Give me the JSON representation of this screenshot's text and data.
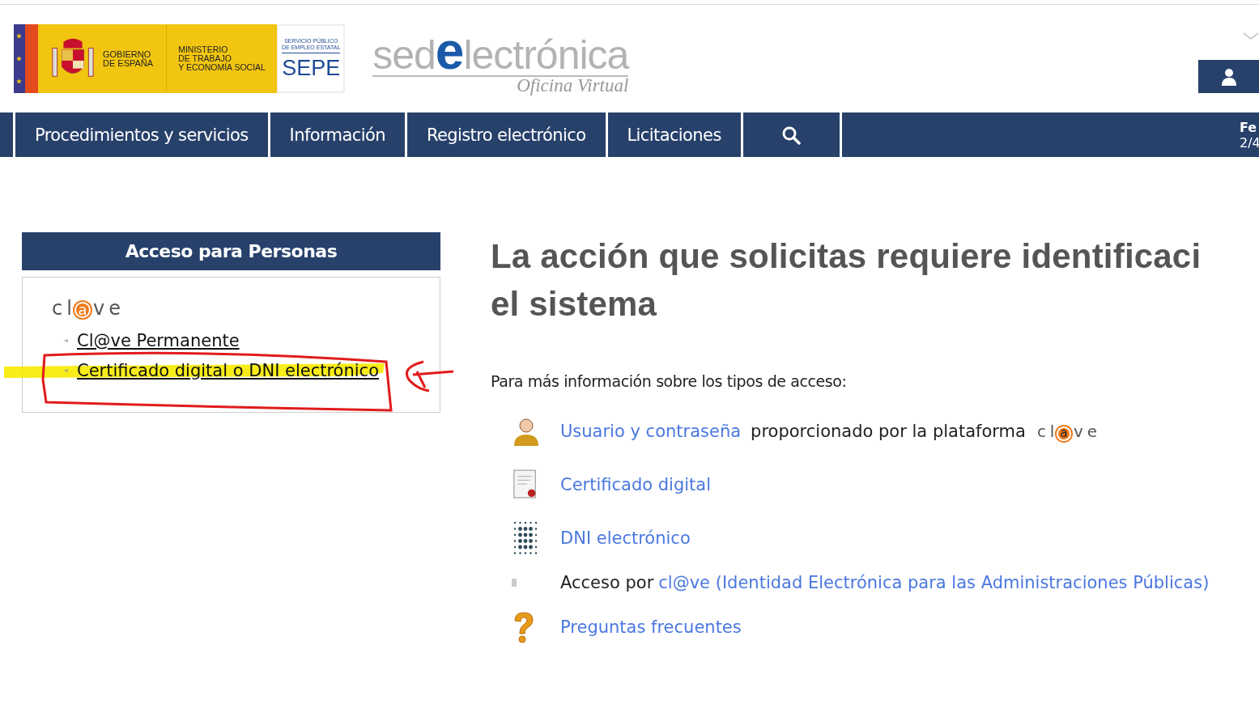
{
  "header": {
    "government": [
      "GOBIERNO",
      "DE ESPAÑA"
    ],
    "ministry": [
      "MINISTERIO",
      "DE TRABAJO",
      "Y ECONOMÍA SOCIAL"
    ],
    "agency": [
      "SERVICIO PÚBLICO",
      "DE EMPLEO ESTATAL"
    ],
    "agency_short": "SEPE",
    "site_title": [
      "sed",
      "e",
      "lectrónica"
    ],
    "site_subtitle": "Oficina Virtual"
  },
  "nav": {
    "items": [
      {
        "label": "Procedimientos y servicios",
        "kind": "text"
      },
      {
        "label": "Información",
        "kind": "text"
      },
      {
        "label": "Registro electrónico",
        "kind": "text"
      },
      {
        "label": "Licitaciones",
        "kind": "text"
      },
      {
        "kind": "search"
      }
    ],
    "date": [
      "Fe",
      "2/4"
    ]
  },
  "access_panel": {
    "title": "Acceso para Personas",
    "logo": [
      "cl",
      "a",
      "ve"
    ],
    "links": [
      {
        "label": "Cl@ve Permanente"
      },
      {
        "label": "Certificado digital o DNI electrónico"
      }
    ]
  },
  "main": {
    "heading": [
      "La acción que solicitas requiere identificaci",
      "el sistema"
    ],
    "intro": "Para más información sobre los tipos de acceso:",
    "items": [
      {
        "kind": "user",
        "link": "Usuario y contraseña",
        "text": "proporcionado por la plataforma",
        "logo": [
          "cl",
          "a",
          "ve"
        ]
      },
      {
        "kind": "certificate",
        "link": "Certificado digital"
      },
      {
        "kind": "dni",
        "link": "DNI electrónico"
      },
      {
        "kind": "clave",
        "text": "Acceso por",
        "link": "cl@ve (Identidad Electrónica para las Administraciones Públicas)"
      },
      {
        "kind": "faq",
        "link": "Preguntas frecuentes"
      }
    ]
  }
}
